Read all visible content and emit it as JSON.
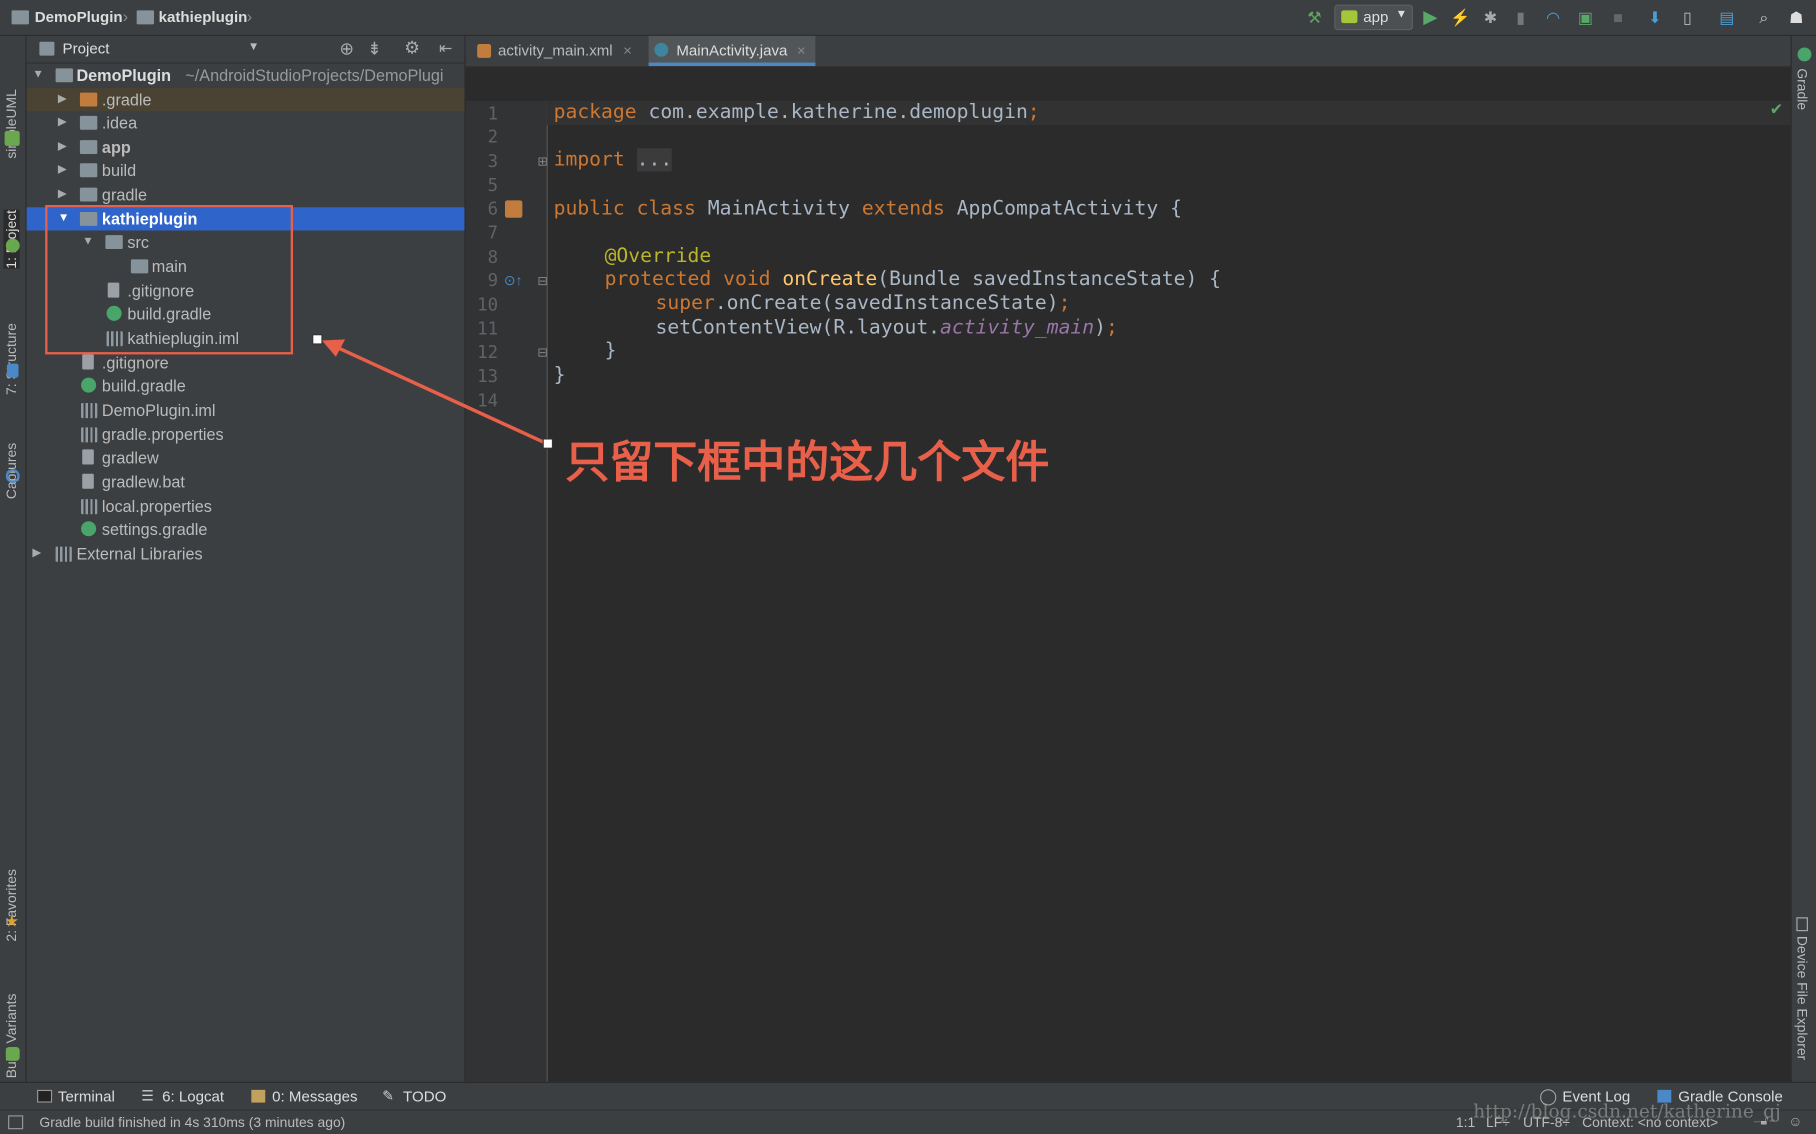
{
  "colors": {
    "accent": "#2f65ca",
    "annotation": "#e8604a",
    "editor_bg": "#2b2b2b",
    "panel_bg": "#3c3f41"
  },
  "navbar": {
    "crumbs": [
      "DemoPlugin",
      "kathieplugin"
    ],
    "run_config": "app",
    "icons": [
      "hammer-icon",
      "run-icon",
      "apply-changes-icon",
      "debug-icon",
      "attach-icon",
      "profile-icon",
      "coverage-icon",
      "stop-icon",
      "sync-icon",
      "avd-icon",
      "sdk-icon",
      "search-icon",
      "account-icon"
    ]
  },
  "left_stripe": {
    "tabs": [
      "simpleUML",
      "1: Project",
      "7: Structure",
      "Captures",
      "2: Favorites",
      "Build Variants"
    ]
  },
  "right_stripe": {
    "tabs": [
      "Gradle",
      "Device File Explorer"
    ]
  },
  "project_panel": {
    "view": "Project",
    "root_label": "DemoPlugin",
    "root_path": "~/AndroidStudioProjects/DemoPlugi",
    "items": [
      {
        "label": ".gradle"
      },
      {
        "label": ".idea"
      },
      {
        "label": "app"
      },
      {
        "label": "build"
      },
      {
        "label": "gradle"
      },
      {
        "label": "kathieplugin"
      },
      {
        "label": "src"
      },
      {
        "label": "main"
      },
      {
        "label": ".gitignore"
      },
      {
        "label": "build.gradle"
      },
      {
        "label": "kathieplugin.iml"
      },
      {
        "label": ".gitignore"
      },
      {
        "label": "build.gradle"
      },
      {
        "label": "DemoPlugin.iml"
      },
      {
        "label": "gradle.properties"
      },
      {
        "label": "gradlew"
      },
      {
        "label": "gradlew.bat"
      },
      {
        "label": "local.properties"
      },
      {
        "label": "settings.gradle"
      },
      {
        "label": "External Libraries"
      }
    ]
  },
  "editor": {
    "tabs": [
      "activity_main.xml",
      "MainActivity.java"
    ],
    "active_tab": "MainActivity.java",
    "line_numbers": [
      "1",
      "2",
      "3",
      "5",
      "6",
      "7",
      "8",
      "9",
      "10",
      "11",
      "12",
      "13",
      "14"
    ],
    "code": {
      "l1_kw": "package",
      "l1_rest": " com.example.katherine.demoplugin",
      "l3_kw": "import",
      "l3_fold": "...",
      "l6_kw": "public class",
      "l6_mid": " MainActivity ",
      "l6_kw2": "extends",
      "l6_rest": " AppCompatActivity {",
      "l8_ann": "@Override",
      "l9_kw": "protected void",
      "l9_fn": " onCreate",
      "l9_rest": "(Bundle savedInstanceState) {",
      "l10_kw": "super",
      "l10_rest": ".onCreate(savedInstanceState)",
      "l11_a": "setContentView(R.layout.",
      "l11_it": "activity_main",
      "l11_b": ")",
      "l12": "}",
      "l13": "}"
    }
  },
  "annotation": {
    "text": "只留下框中的这几个文件"
  },
  "bottom_tabs": [
    "Terminal",
    "6: Logcat",
    "0: Messages",
    "TODO"
  ],
  "bottom_right_tabs": [
    "Event Log",
    "Gradle Console"
  ],
  "status": {
    "message": "Gradle build finished in 4s 310ms (3 minutes ago)",
    "position": "1:1",
    "line_sep": "LF÷",
    "encoding": "UTF-8÷",
    "context": "Context: <no context>"
  },
  "watermark": "http://blog.csdn.net/katherine_qj"
}
